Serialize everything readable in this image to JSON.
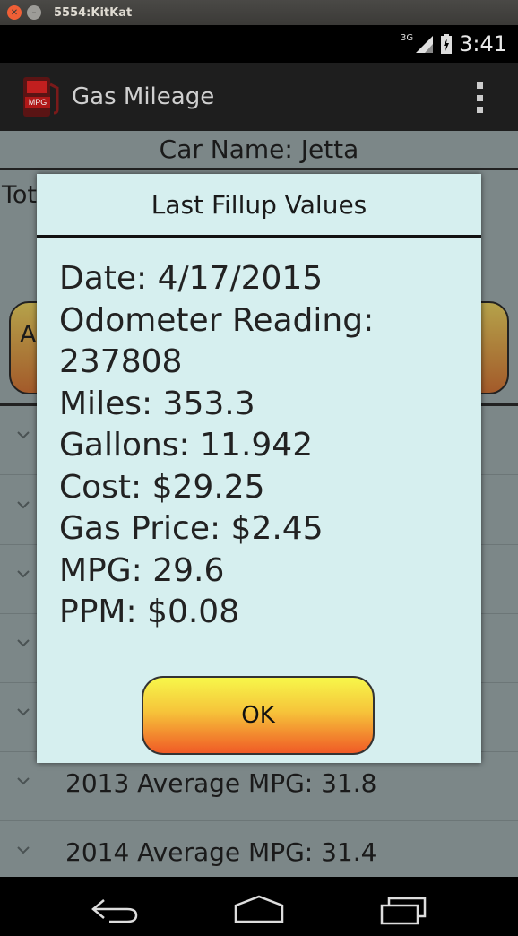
{
  "window": {
    "title": "5554:KitKat"
  },
  "status_bar": {
    "network": "3G",
    "time": "3:41"
  },
  "action_bar": {
    "app_title": "Gas Mileage",
    "icon_label": "MPG"
  },
  "content": {
    "car_name_label": "Car Name: Jetta",
    "totals_label": "Tot",
    "left_button_label": "A",
    "rows": [
      {
        "label": ""
      },
      {
        "label": ""
      },
      {
        "label": ""
      },
      {
        "label": ""
      },
      {
        "label": ""
      },
      {
        "label": "2013  Average MPG: 31.8"
      },
      {
        "label": "2014  Average MPG: 31.4"
      }
    ]
  },
  "dialog": {
    "title": "Last Fillup Values",
    "lines": [
      "Date: 4/17/2015",
      "Odometer Reading:",
      "237808",
      "Miles: 353.3",
      "Gallons: 11.942",
      "Cost: $29.25",
      "Gas Price: $2.45",
      "MPG: 29.6",
      "PPM: $0.08"
    ],
    "ok_label": "OK"
  },
  "icons": {
    "window_close": "close-icon",
    "window_minimize": "minimize-icon",
    "signal": "signal-icon",
    "battery": "battery-icon",
    "app": "gas-pump-icon",
    "overflow": "overflow-menu-icon",
    "back": "back-icon",
    "home": "home-icon",
    "recents": "recents-icon"
  }
}
